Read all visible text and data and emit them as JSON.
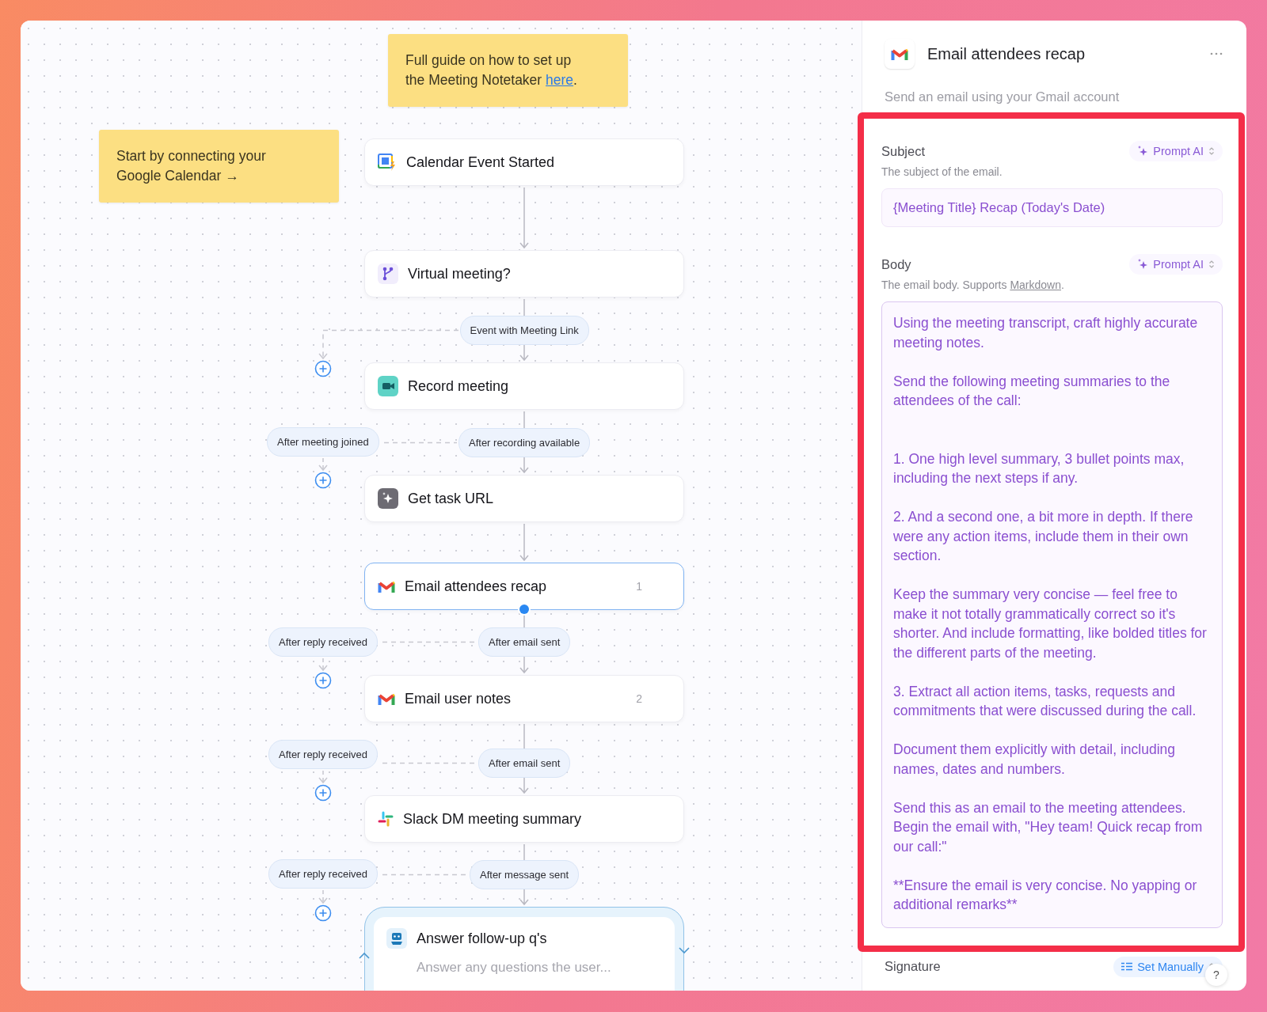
{
  "canvas": {
    "notes": [
      {
        "text_before": "Full guide on how to set up the Meeting Notetaker ",
        "link": "here",
        "text_after": "."
      },
      {
        "text_before": "Start by connecting your Google Calendar →"
      }
    ],
    "steps": [
      {
        "kind": "step",
        "title": "Calendar Event Started",
        "selected": false,
        "side_branch": false
      },
      {
        "kind": "step",
        "title": "Virtual meeting?",
        "selected": false,
        "out_label": "Event with Meeting Link",
        "side_branch": true
      },
      {
        "kind": "step",
        "title": "Record meeting",
        "selected": false,
        "out_label": "After recording available",
        "side_label": "After meeting joined",
        "side_branch": true
      },
      {
        "kind": "step",
        "title": "Get task URL",
        "selected": false,
        "side_branch": false
      },
      {
        "kind": "step",
        "title": "Email attendees recap",
        "badge": "1",
        "selected": true,
        "out_label": "After email sent",
        "side_label": "After reply received",
        "side_branch": true
      },
      {
        "kind": "step",
        "title": "Email user notes",
        "badge": "2",
        "selected": false,
        "out_label": "After email sent",
        "side_label": "After reply received",
        "side_branch": true
      },
      {
        "kind": "step",
        "title": "Slack DM meeting summary",
        "selected": false,
        "out_label": "After message sent",
        "side_label": "After reply received",
        "side_branch": true
      },
      {
        "kind": "loop",
        "title": "Answer follow-up q's",
        "description": "Answer any questions the user...",
        "selected": false,
        "side_branch": false
      }
    ]
  },
  "panel": {
    "title": "Email attendees recap",
    "subtitle": "Send an email using your Gmail account",
    "highlighted": true,
    "fields": [
      {
        "kind": "input",
        "label": "Subject",
        "hint_before": "The subject of the email.",
        "mode": "Prompt AI",
        "value": "{Meeting Title} Recap (Today's Date)"
      },
      {
        "kind": "textarea",
        "label": "Body",
        "hint_before": "The email body. Supports ",
        "hint_link": "Markdown",
        "hint_after": ".",
        "mode": "Prompt AI",
        "value": "Using the meeting transcript, craft highly accurate meeting notes.\n\nSend the following meeting summaries to the attendees of the call:\n\n\n1. One high level summary, 3 bullet points max, including the next steps if any.\n\n2. And a second one, a bit more in depth. If there were any action items, include them in their own section.\n\nKeep the summary very concise — feel free to make it not totally grammatically correct so it's shorter. And include formatting, like bolded titles for the different parts of the meeting.\n\n3. Extract all action items, tasks, requests and commitments that were discussed during the call.\n\nDocument them explicitly with detail, including names, dates and numbers.\n\nSend this as an email to the meeting attendees. Begin the email with, \"Hey team! Quick recap from our call:\"\n\n**Ensure the email is very concise. No yapping or additional remarks**"
      }
    ],
    "signature": {
      "label": "Signature",
      "mode": "Set Manually"
    },
    "help": "?"
  }
}
